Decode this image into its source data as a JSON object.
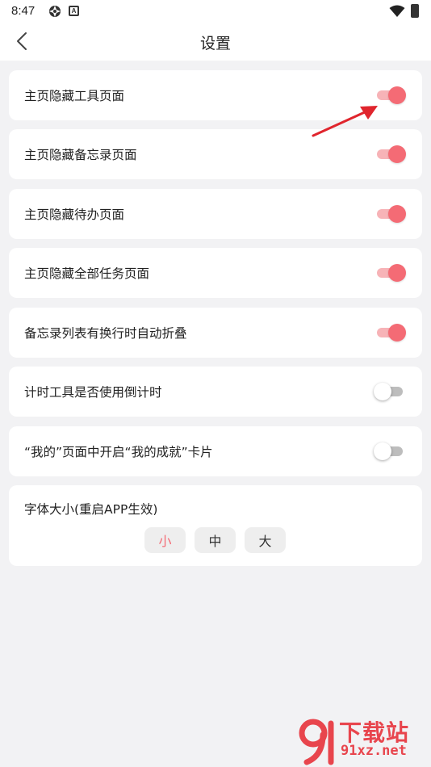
{
  "status_bar": {
    "time": "8:47",
    "badge_letter": "A"
  },
  "header": {
    "title": "设置"
  },
  "settings": [
    {
      "label": "主页隐藏工具页面",
      "enabled": true
    },
    {
      "label": "主页隐藏备忘录页面",
      "enabled": true
    },
    {
      "label": "主页隐藏待办页面",
      "enabled": true
    },
    {
      "label": "主页隐藏全部任务页面",
      "enabled": true
    },
    {
      "label": "备忘录列表有换行时自动折叠",
      "enabled": true
    },
    {
      "label": "计时工具是否使用倒计时",
      "enabled": false
    },
    {
      "label": "“我的”页面中开启“我的成就”卡片",
      "enabled": false
    }
  ],
  "font_size": {
    "title": "字体大小(重启APP生效)",
    "options": [
      "小",
      "中",
      "大"
    ],
    "selected": "小"
  },
  "watermark": {
    "brand": "下载站",
    "url": "91xz.net"
  },
  "colors": {
    "accent": "#f46b75",
    "track_on": "#f7b3b7",
    "background": "#f2f2f4",
    "annotation_arrow": "#e0252d"
  }
}
